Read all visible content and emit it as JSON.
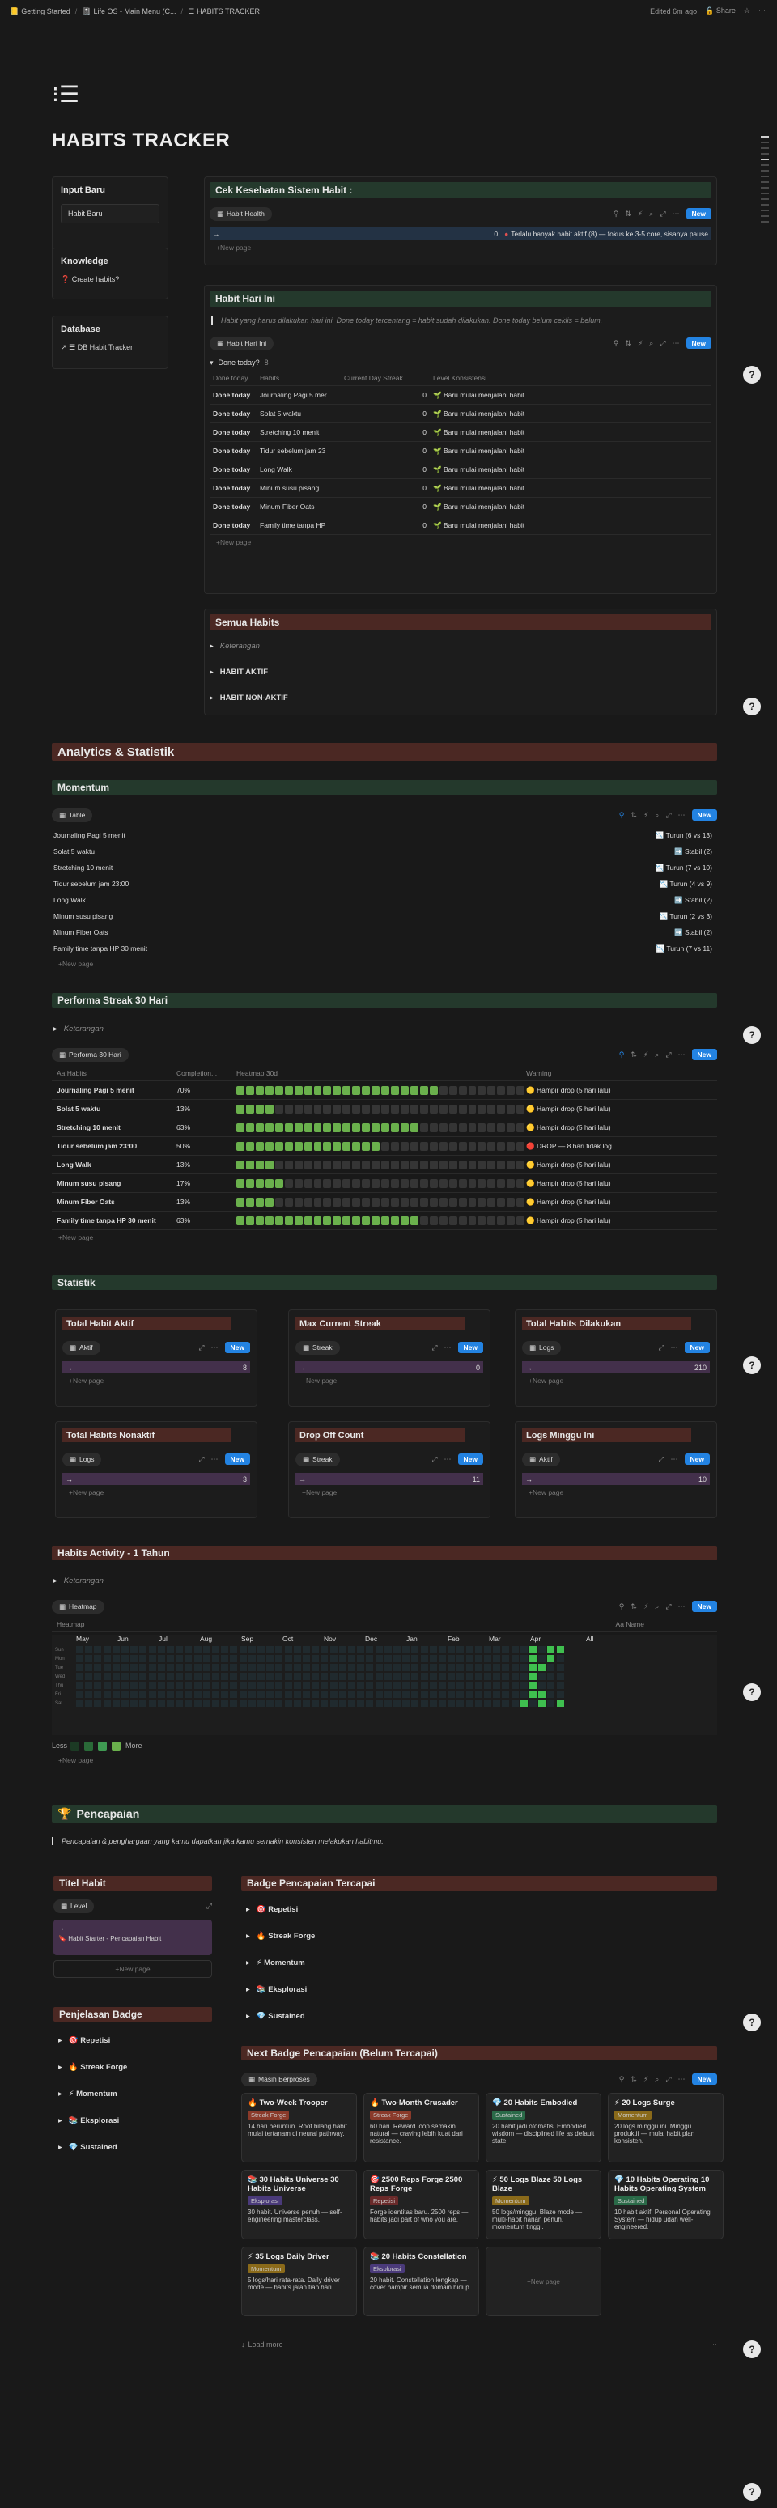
{
  "topbar": {
    "crumbs": [
      "Getting Started",
      "Life OS - Main Menu (C...",
      "HABITS TRACKER"
    ],
    "edited": "Edited 6m ago",
    "share": "Share"
  },
  "page": {
    "title": "HABITS TRACKER"
  },
  "sidebar": {
    "input_title": "Input Baru",
    "input_btn": "Habit Baru",
    "knowledge_title": "Knowledge",
    "knowledge_btn": "Create habits?",
    "database_title": "Database",
    "database_btn": "DB Habit Tracker"
  },
  "health": {
    "title": "Cek Kesehatan Sistem Habit :",
    "view": "Habit Health",
    "new": "New",
    "row_arrow": "→",
    "row_value": "0",
    "row_text": "Terlalu banyak habit aktif (8) — fokus ke 3-5 core, sisanya pause",
    "new_page": "New page"
  },
  "today": {
    "title": "Habit Hari Ini",
    "quote": "Habit yang harus dilakukan hari ini. Done today tercentang = habit sudah dilakukan. Done today belum ceklis = belum.",
    "view": "Habit Hari Ini",
    "new": "New",
    "group": "Done today?",
    "group_count": "8",
    "cols": [
      "Done today",
      "Habits",
      "Current Day Streak",
      "Level Konsistensi"
    ],
    "rows": [
      {
        "done": "Done today",
        "habit": "Journaling Pagi 5 mer",
        "streak": "0",
        "level": "Baru mulai menjalani habit"
      },
      {
        "done": "Done today",
        "habit": "Solat 5 waktu",
        "streak": "0",
        "level": "Baru mulai menjalani habit"
      },
      {
        "done": "Done today",
        "habit": "Stretching 10 menit",
        "streak": "0",
        "level": "Baru mulai menjalani habit"
      },
      {
        "done": "Done today",
        "habit": "Tidur sebelum jam 23",
        "streak": "0",
        "level": "Baru mulai menjalani habit"
      },
      {
        "done": "Done today",
        "habit": "Long Walk",
        "streak": "0",
        "level": "Baru mulai menjalani habit"
      },
      {
        "done": "Done today",
        "habit": "Minum susu pisang",
        "streak": "0",
        "level": "Baru mulai menjalani habit"
      },
      {
        "done": "Done today",
        "habit": "Minum Fiber Oats",
        "streak": "0",
        "level": "Baru mulai menjalani habit"
      },
      {
        "done": "Done today",
        "habit": "Family time tanpa HP",
        "streak": "0",
        "level": "Baru mulai menjalani habit"
      }
    ],
    "new_page": "New page"
  },
  "all": {
    "title": "Semua Habits",
    "toggles": [
      "Keterangan",
      "HABIT AKTIF",
      "HABIT NON-AKTIF"
    ]
  },
  "analytics": {
    "title": "Analytics & Statistik"
  },
  "momentum": {
    "title": "Momentum",
    "view": "Table",
    "new": "New",
    "rows": [
      {
        "name": "Journaling Pagi 5 menit",
        "status": "Turun (6 vs 13)"
      },
      {
        "name": "Solat 5 waktu",
        "status": "Stabil (2)"
      },
      {
        "name": "Stretching 10 menit",
        "status": "Turun (7 vs 10)"
      },
      {
        "name": "Tidur sebelum jam 23:00",
        "status": "Turun (4 vs 9)"
      },
      {
        "name": "Long Walk",
        "status": "Stabil (2)"
      },
      {
        "name": "Minum susu pisang",
        "status": "Turun (2 vs 3)"
      },
      {
        "name": "Minum Fiber Oats",
        "status": "Stabil (2)"
      },
      {
        "name": "Family time tanpa HP 30 menit",
        "status": "Turun (7 vs 11)"
      }
    ],
    "new_page": "New page"
  },
  "perf": {
    "title": "Performa Streak 30 Hari",
    "keterangan": "Keterangan",
    "view": "Performa 30 Hari",
    "new": "New",
    "cols": [
      "Habits",
      "Completion...",
      "Heatmap 30d",
      "Warning"
    ],
    "rows": [
      {
        "name": "Journaling Pagi 5 menit",
        "pct": "70%",
        "on": 21,
        "warn": "Hampir drop (5 hari lalu)"
      },
      {
        "name": "Solat 5 waktu",
        "pct": "13%",
        "on": 4,
        "warn": "Hampir drop (5 hari lalu)"
      },
      {
        "name": "Stretching 10 menit",
        "pct": "63%",
        "on": 19,
        "warn": "Hampir drop (5 hari lalu)"
      },
      {
        "name": "Tidur sebelum jam 23:00",
        "pct": "50%",
        "on": 15,
        "warn": "DROP — 8 hari tidak log"
      },
      {
        "name": "Long Walk",
        "pct": "13%",
        "on": 4,
        "warn": "Hampir drop (5 hari lalu)"
      },
      {
        "name": "Minum susu pisang",
        "pct": "17%",
        "on": 5,
        "warn": "Hampir drop (5 hari lalu)"
      },
      {
        "name": "Minum Fiber Oats",
        "pct": "13%",
        "on": 4,
        "warn": "Hampir drop (5 hari lalu)"
      },
      {
        "name": "Family time tanpa HP 30 menit",
        "pct": "63%",
        "on": 19,
        "warn": "Hampir drop (5 hari lalu)"
      }
    ],
    "new_page": "New page"
  },
  "statistik": {
    "title": "Statistik",
    "cards": [
      {
        "title": "Total Habit Aktif",
        "view": "Aktif",
        "value": "8"
      },
      {
        "title": "Max Current Streak",
        "view": "Streak",
        "value": "0"
      },
      {
        "title": "Total Habits Dilakukan",
        "view": "Logs",
        "value": "210"
      },
      {
        "title": "Total Habits Nonaktif",
        "view": "Logs",
        "value": "3"
      },
      {
        "title": "Drop Off Count",
        "view": "Streak",
        "value": "11"
      },
      {
        "title": "Logs Minggu Ini",
        "view": "Aktif",
        "value": "10"
      }
    ],
    "arrow": "→",
    "new": "New",
    "new_page": "New page"
  },
  "activity": {
    "title": "Habits Activity - 1 Tahun",
    "keterangan": "Keterangan",
    "view": "Heatmap",
    "prop": "Heatmap",
    "name_col": "Name",
    "new": "New",
    "months": [
      "May",
      "Jun",
      "Jul",
      "Aug",
      "Sep",
      "Oct",
      "Nov",
      "Dec",
      "Jan",
      "Feb",
      "Mar",
      "Apr"
    ],
    "all": "All",
    "days": [
      "Sun",
      "Mon",
      "Tue",
      "Wed",
      "Thu",
      "Fri",
      "Sat"
    ],
    "less": "Less",
    "more": "More",
    "new_page": "New page"
  },
  "achievement": {
    "title": "Pencapaian",
    "quote": "Pencapaian & penghargaan yang kamu dapatkan jika kamu semakin konsisten melakukan habitmu.",
    "titel": "Titel Habit",
    "level": "Level",
    "level_arrow": "→",
    "level_value": "Habit Starter - Pencapaian Habit",
    "new_page": "New page",
    "penjelasan": "Penjelasan Badge",
    "badges": [
      "Repetisi",
      "Streak Forge",
      "Momentum",
      "Eksplorasi",
      "Sustained"
    ],
    "tercapai": "Badge Pencapaian Tercapai",
    "next": "Next Badge Pencapaian (Belum Tercapai)",
    "next_view": "Masih Berproses",
    "new": "New",
    "cards": [
      {
        "name": "Two-Week Trooper",
        "tag": "Streak Forge",
        "desc": "14 hari beruntun. Root bilang habit mulai tertanam di neural pathway."
      },
      {
        "name": "Two-Month Crusader",
        "tag": "Streak Forge",
        "desc": "60 hari. Reward loop semakin natural — craving lebih kuat dari resistance."
      },
      {
        "name": "20 Habits Embodied",
        "tag": "Sustained",
        "desc": "20 habit jadi otomatis. Embodied wisdom — disciplined life as default state."
      },
      {
        "name": "20 Logs Surge",
        "tag": "Momentum",
        "desc": "20 logs minggu ini. Minggu produktif — mulai habit plan konsisten."
      },
      {
        "name": "30 Habits Universe 30 Habits Universe",
        "tag": "Eksplorasi",
        "desc": "30 habit. Universe penuh — self-engineering masterclass."
      },
      {
        "name": "2500 Reps Forge 2500 Reps Forge",
        "tag": "Repetisi",
        "desc": "Forge identitas baru. 2500 reps — habits jadi part of who you are."
      },
      {
        "name": "50 Logs Blaze 50 Logs Blaze",
        "tag": "Momentum",
        "desc": "50 logs/minggu. Blaze mode — multi-habit harian penuh, momentum tinggi."
      },
      {
        "name": "10 Habits Operating 10 Habits Operating System",
        "tag": "Sustained",
        "desc": "10 habit aktif. Personal Operating System — hidup udah well-engineered."
      },
      {
        "name": "35 Logs Daily Driver",
        "tag": "Momentum",
        "desc": "5 logs/hari rata-rata. Daily driver mode — habits jalan tiap hari."
      },
      {
        "name": "20 Habits Constellation",
        "tag": "Eksplorasi",
        "desc": "20 habit. Constellation lengkap — cover hampir semua domain hidup."
      }
    ],
    "load_more": "Load more"
  },
  "colors": {
    "accent": "#2383e2",
    "green_header": "#24392c",
    "red_header": "#4b2823",
    "purple_bar": "#43304b",
    "heat": "#6ab04c"
  }
}
